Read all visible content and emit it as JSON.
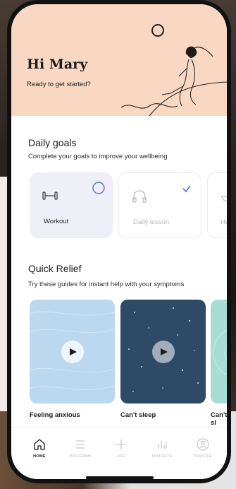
{
  "header": {
    "greeting": "Hi Mary",
    "subtitle": "Ready to get started?"
  },
  "daily_goals": {
    "title": "Daily goals",
    "subtitle": "Complete your goals to improve your wellbeing",
    "cards": [
      {
        "label": "Workout",
        "icon": "dumbbell-icon",
        "state": "incomplete"
      },
      {
        "label": "Daily lesson",
        "icon": "headphones-icon",
        "state": "complete"
      },
      {
        "label": "Hea",
        "icon": "bowl-icon",
        "state": "incomplete"
      }
    ]
  },
  "quick_relief": {
    "title": "Quick Relief",
    "subtitle": "Try these guides for instant help with your symptoms",
    "cards": [
      {
        "label": "Feeling anxious"
      },
      {
        "label": "Can't sleep"
      },
      {
        "label": "Can't sl"
      }
    ]
  },
  "nav": {
    "items": [
      {
        "label": "HOME",
        "icon": "home-icon",
        "active": true
      },
      {
        "label": "PROGRAM",
        "icon": "list-icon",
        "active": false
      },
      {
        "label": "LOG",
        "icon": "plus-icon",
        "active": false
      },
      {
        "label": "INSIGHTS",
        "icon": "bar-chart-icon",
        "active": false
      },
      {
        "label": "PROFILE",
        "icon": "profile-icon",
        "active": false
      }
    ]
  },
  "colors": {
    "header_bg": "#f8d8c2",
    "accent": "#5c6fd6",
    "anxious_card": "#bcd8ef",
    "sleep_card": "#2f4a66",
    "third_card": "#a9dcd6"
  }
}
